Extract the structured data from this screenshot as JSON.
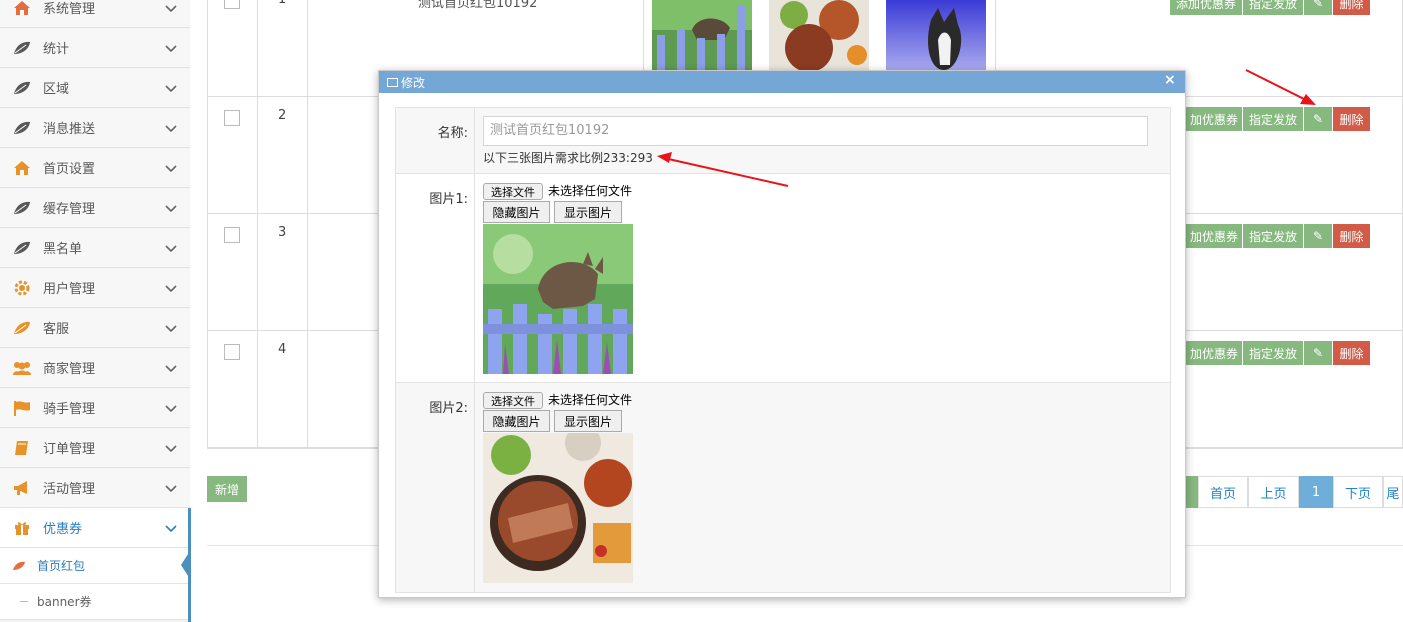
{
  "sidebar": {
    "items": [
      {
        "label": "系统管理",
        "icon": "home-icon",
        "color": "#e36e3f"
      },
      {
        "label": "统计",
        "icon": "leaf-icon",
        "color": "#585858"
      },
      {
        "label": "区域",
        "icon": "leaf-icon",
        "color": "#585858"
      },
      {
        "label": "消息推送",
        "icon": "leaf-icon",
        "color": "#585858"
      },
      {
        "label": "首页设置",
        "icon": "home-icon",
        "color": "#e8932a"
      },
      {
        "label": "缓存管理",
        "icon": "leaf-icon",
        "color": "#585858"
      },
      {
        "label": "黑名单",
        "icon": "leaf-icon",
        "color": "#585858"
      },
      {
        "label": "用户管理",
        "icon": "gear-icon",
        "color": "#e8932a"
      },
      {
        "label": "客服",
        "icon": "leaf-icon",
        "color": "#e8932a"
      },
      {
        "label": "商家管理",
        "icon": "users-icon",
        "color": "#e8932a"
      },
      {
        "label": "骑手管理",
        "icon": "flag-icon",
        "color": "#e8932a"
      },
      {
        "label": "订单管理",
        "icon": "book-icon",
        "color": "#e8932a"
      },
      {
        "label": "活动管理",
        "icon": "bullhorn-icon",
        "color": "#e8932a"
      },
      {
        "label": "优惠券",
        "icon": "gift-icon",
        "color": "#e8932a"
      }
    ],
    "sub_items": [
      {
        "label": "首页红包"
      },
      {
        "label": "banner券"
      }
    ]
  },
  "table": {
    "rows": [
      {
        "index": "1",
        "name": "测试首页红包10192"
      },
      {
        "index": "2"
      },
      {
        "index": "3"
      },
      {
        "index": "4"
      }
    ],
    "actions": {
      "add_coupon": "添加优惠券",
      "add_coupon_partial": "加优惠券",
      "assign": "指定发放",
      "delete": "删除"
    }
  },
  "footer": {
    "add_label": "新增",
    "pager": {
      "first": "首页",
      "prev": "上页",
      "current": "1",
      "next": "下页",
      "last_partial": "尾"
    }
  },
  "modal": {
    "title": "修改",
    "close": "×",
    "name_label": "名称:",
    "name_value": "测试首页红包10192",
    "hint": "以下三张图片需求比例233:293",
    "pic1_label": "图片1:",
    "pic2_label": "图片2:",
    "choose_file": "选择文件",
    "no_file": "未选择任何文件",
    "hide_pic": "隐藏图片",
    "show_pic": "显示图片"
  }
}
